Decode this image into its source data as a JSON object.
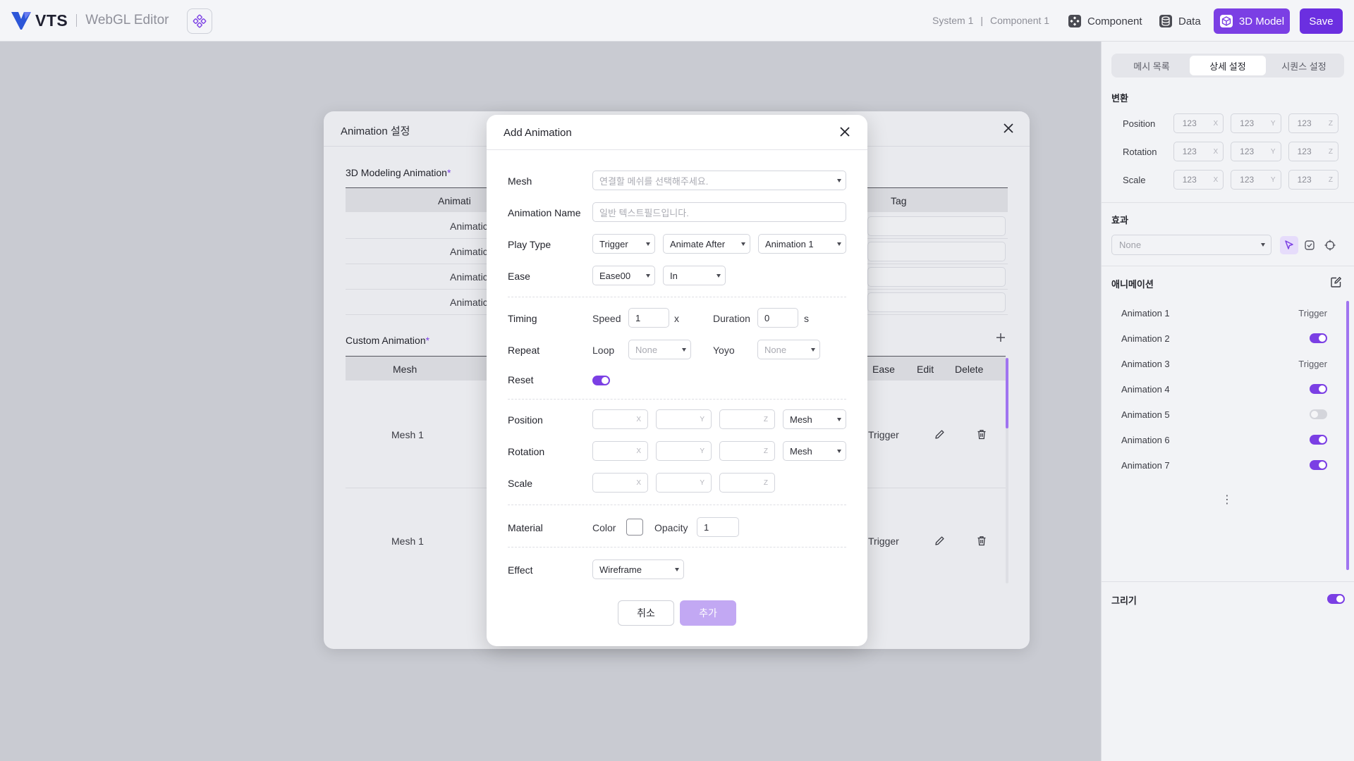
{
  "header": {
    "brand": "VTS",
    "app_name": "WebGL Editor",
    "breadcrumb": [
      "System 1",
      "|",
      "Component 1"
    ],
    "nav": {
      "component": "Component",
      "data": "Data",
      "model": "3D Model"
    },
    "save_label": "Save",
    "accent_color": "#7b3fe4"
  },
  "right_panel": {
    "tabs": [
      "메시 목록",
      "상세 설정",
      "시퀀스 설정"
    ],
    "active_tab": "상세 설정",
    "transform_title": "변환",
    "transform": [
      {
        "label": "Position",
        "x": "123",
        "y": "123",
        "z": "123"
      },
      {
        "label": "Rotation",
        "x": "123",
        "y": "123",
        "z": "123"
      },
      {
        "label": "Scale",
        "x": "123",
        "y": "123",
        "z": "123"
      }
    ],
    "axis": {
      "x": "X",
      "y": "Y",
      "z": "Z"
    },
    "effect_title": "효과",
    "effect_value": "None",
    "animation_title": "애니메이션",
    "animations": [
      {
        "name": "Animation 1",
        "value": "Trigger",
        "toggle": null
      },
      {
        "name": "Animation 2",
        "value": "",
        "toggle": true
      },
      {
        "name": "Animation 3",
        "value": "Trigger",
        "toggle": null
      },
      {
        "name": "Animation 4",
        "value": "",
        "toggle": true
      },
      {
        "name": "Animation 5",
        "value": "",
        "toggle": false
      },
      {
        "name": "Animation 6",
        "value": "",
        "toggle": true
      },
      {
        "name": "Animation 7",
        "value": "",
        "toggle": true
      }
    ],
    "draw_title": "그리기",
    "draw_enabled": true
  },
  "bg_modal": {
    "title": "Animation 설정",
    "modeling_title": "3D Modeling Animation",
    "required_mark": "*",
    "modeling_headers": {
      "name": "Animati",
      "tag": "Tag"
    },
    "modeling_rows": [
      "Animatic",
      "Animatic",
      "Animatic",
      "Animatic"
    ],
    "custom_title": "Custom Animation",
    "custom_headers": {
      "mesh": "Mesh",
      "ease": "Ease",
      "edit": "Edit",
      "delete": "Delete"
    },
    "custom_rows": [
      {
        "mesh": "Mesh 1",
        "ease": "Trigger"
      },
      {
        "mesh": "Mesh 1",
        "ease": "Trigger"
      }
    ]
  },
  "dialog": {
    "title": "Add Animation",
    "mesh_label": "Mesh",
    "mesh_placeholder": "연결할 메쉬를 선택해주세요.",
    "name_label": "Animation Name",
    "name_placeholder": "일반 텍스트필드입니다.",
    "play_type_label": "Play Type",
    "play_type": [
      "Trigger",
      "Animate After",
      "Animation 1"
    ],
    "ease_label": "Ease",
    "ease": [
      "Ease00",
      "In"
    ],
    "timing_label": "Timing",
    "speed_label": "Speed",
    "speed_value": "1",
    "speed_unit": "x",
    "duration_label": "Duration",
    "duration_value": "0",
    "duration_unit": "s",
    "repeat_label": "Repeat",
    "loop_label": "Loop",
    "loop_value": "None",
    "yoyo_label": "Yoyo",
    "yoyo_value": "None",
    "reset_label": "Reset",
    "reset_on": true,
    "position_label": "Position",
    "rotation_label": "Rotation",
    "scale_label": "Scale",
    "axis": {
      "x": "X",
      "y": "Y",
      "z": "Z"
    },
    "position_space": "Mesh",
    "rotation_space": "Mesh",
    "material_label": "Material",
    "color_label": "Color",
    "opacity_label": "Opacity",
    "opacity_value": "1",
    "effect_label": "Effect",
    "effect_value": "Wireframe",
    "cancel_label": "취소",
    "add_label": "추가"
  }
}
